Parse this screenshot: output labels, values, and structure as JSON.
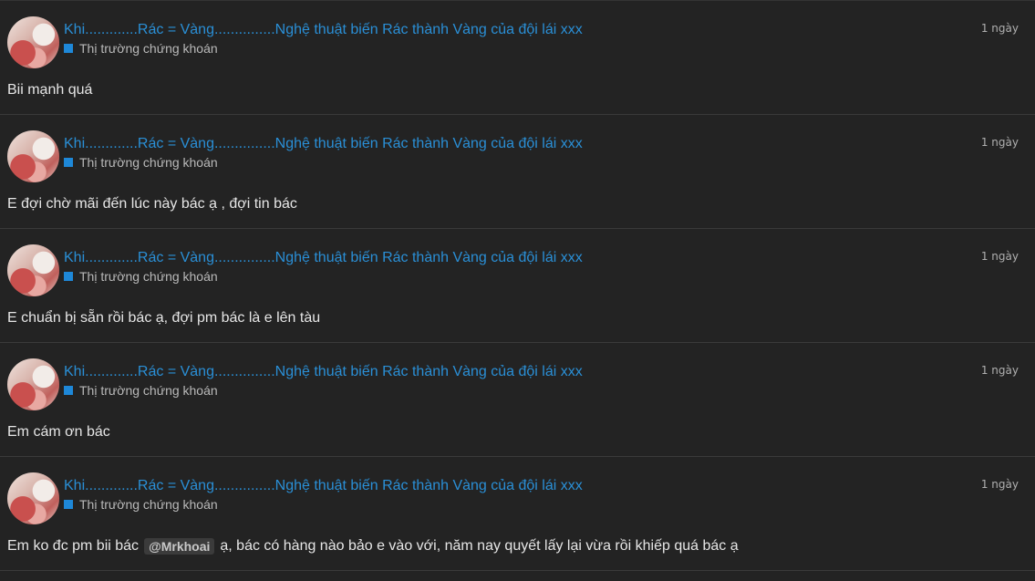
{
  "accent_color": "#2a8fd6",
  "category_color": "#1e88d8",
  "posts": [
    {
      "title": "Khi.............Rác = Vàng...............Nghệ thuật biến Rác thành Vàng của đội lái xxx",
      "category": "Thị trường chứng khoán",
      "time": "1 ngày",
      "body_before": "Bii mạnh quá",
      "mention": "",
      "body_after": ""
    },
    {
      "title": "Khi.............Rác = Vàng...............Nghệ thuật biến Rác thành Vàng của đội lái xxx",
      "category": "Thị trường chứng khoán",
      "time": "1 ngày",
      "body_before": "E đợi chờ mãi đến lúc này bác ạ , đợi tin bác",
      "mention": "",
      "body_after": ""
    },
    {
      "title": "Khi.............Rác = Vàng...............Nghệ thuật biến Rác thành Vàng của đội lái xxx",
      "category": "Thị trường chứng khoán",
      "time": "1 ngày",
      "body_before": "E chuẩn bị sẵn rồi bác ạ, đợi pm bác là e lên tàu",
      "mention": "",
      "body_after": ""
    },
    {
      "title": "Khi.............Rác = Vàng...............Nghệ thuật biến Rác thành Vàng của đội lái xxx",
      "category": "Thị trường chứng khoán",
      "time": "1 ngày",
      "body_before": "Em cám ơn bác",
      "mention": "",
      "body_after": ""
    },
    {
      "title": "Khi.............Rác = Vàng...............Nghệ thuật biến Rác thành Vàng của đội lái xxx",
      "category": "Thị trường chứng khoán",
      "time": "1 ngày",
      "body_before": "Em ko đc pm bii bác",
      "mention": "@Mrkhoai",
      "body_after": "ạ, bác có hàng nào bảo e vào với, năm nay quyết lấy lại vừa rồi khiếp quá bác ạ"
    }
  ]
}
